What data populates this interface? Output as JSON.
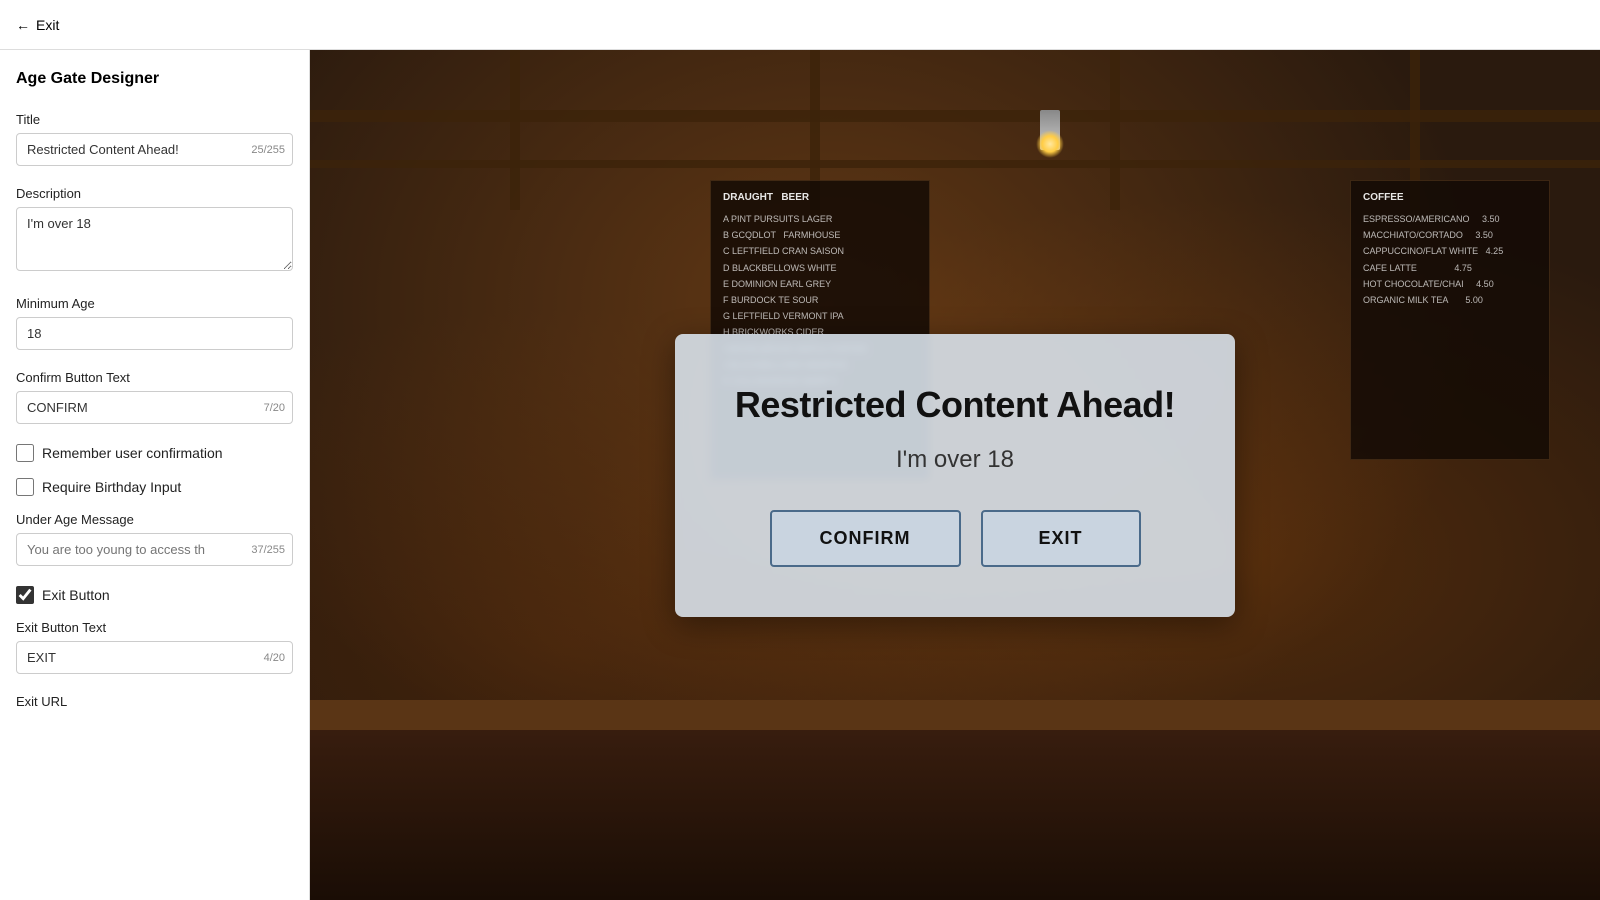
{
  "topbar": {
    "exit_label": "Exit"
  },
  "sidebar": {
    "title": "Age Gate Designer",
    "fields": {
      "title_label": "Title",
      "title_value": "Restricted Content Ahead!",
      "title_char_count": "25/255",
      "description_label": "Description",
      "description_value": "I'm over 18",
      "min_age_label": "Minimum Age",
      "min_age_value": "18",
      "confirm_btn_text_label": "Confirm Button Text",
      "confirm_btn_text_value": "CONFIRM",
      "confirm_btn_char_count": "7/20",
      "remember_label": "Remember user confirmation",
      "birthday_label": "Require Birthday Input",
      "under_age_label": "Under Age Message",
      "under_age_placeholder": "You are too young to access th",
      "under_age_char_count": "37/255",
      "exit_button_label": "Exit Button",
      "exit_button_checked": true,
      "exit_btn_text_label": "Exit Button Text",
      "exit_btn_text_value": "EXIT",
      "exit_btn_char_count": "4/20",
      "exit_url_label": "Exit URL"
    }
  },
  "modal": {
    "title": "Restricted Content Ahead!",
    "description": "I'm over 18",
    "confirm_btn": "CONFIRM",
    "exit_btn": "EXIT"
  },
  "menu_left": {
    "header": "DRAUGHT  BEER",
    "items": [
      "A PINT PURSUITS LAGER",
      "B GCQDLOT  FARMHOUSE",
      "C LEFTFIELD CRAN SAISON",
      "D BLACKBELLOWS WHITE",
      "E DOMINION EARL GREY",
      "F BURDOCK TE SOUR",
      "G LEFTFIELD VERMONT IPA",
      "H BRICKWORKS CIDER",
      "I MICKELBROOK MAPLE PORTER",
      "J BLACKBELLOWS MEMPHIS",
      "K COLLINGWOOD WARP 9"
    ]
  },
  "menu_right": {
    "header": "COFFEE",
    "items": [
      "ESPRESSO/AMERICANO",
      "MACCHIATO/CORTADO",
      "CAPPUCCINO/FLAT WHITE",
      "CAFE LATTE",
      "HOT CHOCOLATE/CHAI",
      "ORGANIC MILK TEA"
    ]
  }
}
